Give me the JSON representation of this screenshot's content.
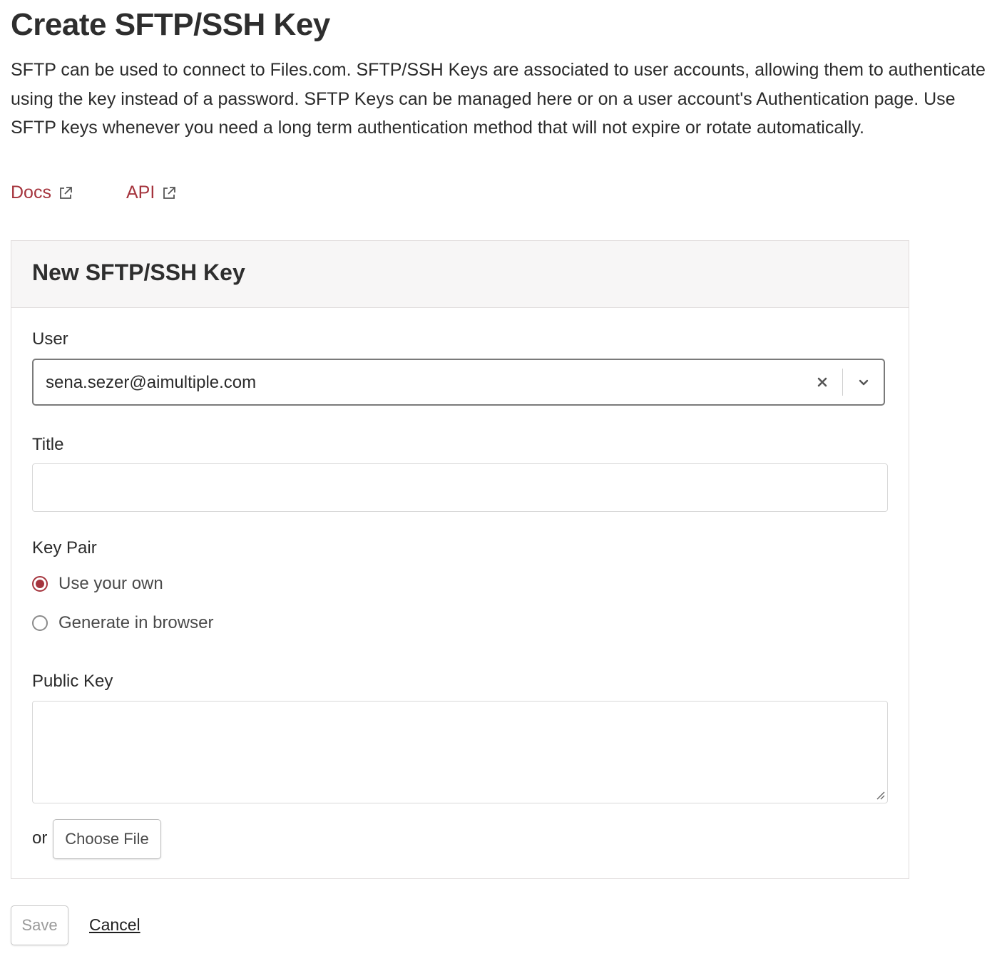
{
  "page": {
    "title": "Create SFTP/SSH Key",
    "description": "SFTP can be used to connect to Files.com. SFTP/SSH Keys are associated to user accounts, allowing them to authenticate using the key instead of a password. SFTP Keys can be managed here or on a user account's Authentication page. Use SFTP keys whenever you need a long term authentication method that will not expire or rotate automatically."
  },
  "links": {
    "docs_label": "Docs",
    "api_label": "API"
  },
  "form": {
    "heading": "New SFTP/SSH Key",
    "user": {
      "label": "User",
      "value": "sena.sezer@aimultiple.com"
    },
    "title_field": {
      "label": "Title",
      "value": ""
    },
    "key_pair": {
      "label": "Key Pair",
      "options": [
        {
          "label": "Use your own",
          "selected": true
        },
        {
          "label": "Generate in browser",
          "selected": false
        }
      ]
    },
    "public_key": {
      "label": "Public Key",
      "value": "",
      "or_label": "or",
      "choose_file_label": "Choose File"
    }
  },
  "actions": {
    "save_label": "Save",
    "cancel_label": "Cancel"
  },
  "colors": {
    "accent": "#a5343d",
    "text": "#2b2b2b",
    "border": "#e0dcdc",
    "header_bg": "#f7f6f6"
  },
  "icons": {
    "external_link": "external-link-icon",
    "clear": "close-icon",
    "dropdown": "chevron-down-icon"
  }
}
